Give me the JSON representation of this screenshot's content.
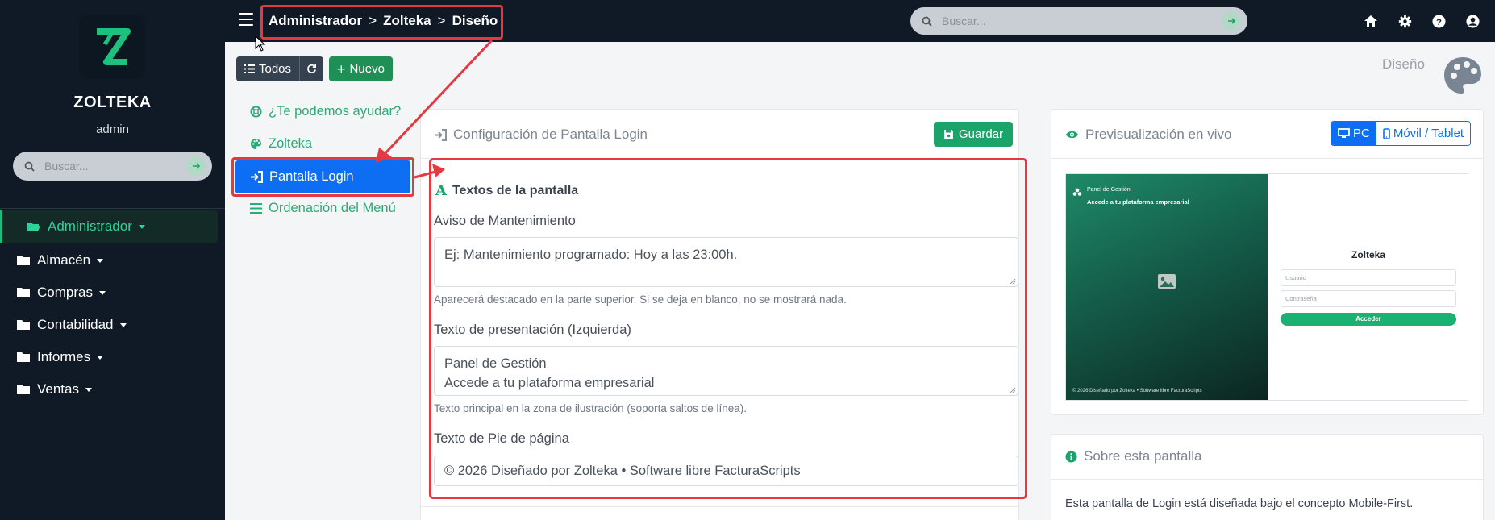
{
  "sidebar": {
    "brand": "ZOLTEKA",
    "user": "admin",
    "search_placeholder": "Buscar...",
    "active_item": "Administrador",
    "items": [
      "Almacén",
      "Compras",
      "Contabilidad",
      "Informes",
      "Ventas"
    ]
  },
  "topbar": {
    "breadcrumbs": [
      "Administrador",
      "Zolteka",
      "Diseño"
    ],
    "search_placeholder": "Buscar...",
    "icons": [
      "home-icon",
      "gear-icon",
      "help-icon",
      "user-icon"
    ]
  },
  "toolbar": {
    "todos_label": "Todos",
    "nuevo_label": "Nuevo"
  },
  "page_label": "Diseño",
  "subnav": {
    "help": "¿Te podemos ayudar?",
    "zolteka": "Zolteka",
    "active": "Pantalla Login",
    "menu_order": "Ordenación del Menú"
  },
  "config": {
    "title": "Configuración de Pantalla Login",
    "save_label": "Guardar",
    "section_title": "Textos de la pantalla",
    "maintenance_label": "Aviso de Mantenimiento",
    "maintenance_placeholder": "Ej: Mantenimiento programado: Hoy a las 23:00h.",
    "maintenance_help": "Aparecerá destacado en la parte superior. Si se deja en blanco, no se mostrará nada.",
    "presentation_label": "Texto de presentación (Izquierda)",
    "presentation_line1": "Panel de Gestión",
    "presentation_line2": "Accede a tu plataforma empresarial",
    "presentation_help": "Texto principal en la zona de ilustración (soporta saltos de línea).",
    "footer_label": "Texto de Pie de página",
    "footer_value": "© 2026 Diseñado por Zolteka • Software libre FacturaScripts"
  },
  "preview": {
    "title": "Previsualización en vivo",
    "pc_label": "PC",
    "mobile_label": "Móvil / Tablet",
    "brand": "Panel de Gestión",
    "subtitle": "Accede a tu plataforma empresarial",
    "footer": "© 2026 Diseñado por Zolteka • Software libre FacturaScripts",
    "login_title": "Zolteka",
    "user_placeholder": "Usuario",
    "password_placeholder": "Contraseña",
    "login_button": "Acceder"
  },
  "about": {
    "title": "Sobre esta pantalla",
    "text": "Esta pantalla de Login está diseñada bajo el concepto Mobile-First."
  },
  "colors": {
    "sidebar_bg": "#101a26",
    "accent_green": "#1ba36a",
    "primary_blue": "#0d6ef4",
    "annotation_red": "#e53940"
  }
}
